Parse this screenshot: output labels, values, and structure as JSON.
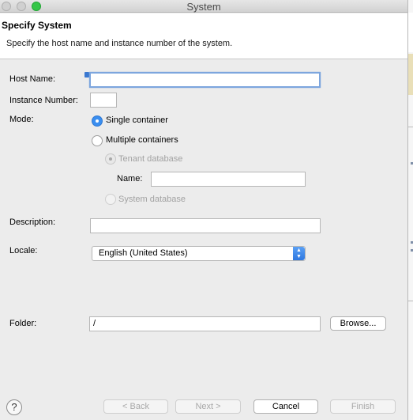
{
  "window": {
    "title": "System"
  },
  "header": {
    "title": "Specify System",
    "description": "Specify the host name and instance number of the system."
  },
  "form": {
    "host_name_label": "Host Name:",
    "host_name_value": "",
    "instance_number_label": "Instance Number:",
    "instance_number_value": "",
    "mode_label": "Mode:",
    "mode_single": "Single container",
    "mode_multiple": "Multiple containers",
    "tenant_database": "Tenant database",
    "name_label": "Name:",
    "name_value": "",
    "system_database": "System database",
    "description_label": "Description:",
    "description_value": "",
    "locale_label": "Locale:",
    "locale_value": "English (United States)",
    "folder_label": "Folder:",
    "folder_value": "/",
    "browse_button": "Browse..."
  },
  "footer": {
    "help": "?",
    "back": "< Back",
    "next": "Next >",
    "cancel": "Cancel",
    "finish": "Finish"
  },
  "colors": {
    "accent": "#3a8ef0",
    "focus_ring": "#7da6de"
  }
}
